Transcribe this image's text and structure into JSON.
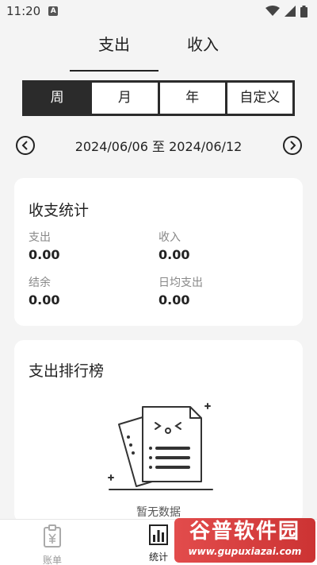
{
  "status_bar": {
    "time": "11:20",
    "notif_letter": "A",
    "icons": [
      "wifi-icon",
      "signal-icon",
      "battery-icon"
    ]
  },
  "type_tabs": [
    {
      "label": "支出",
      "active": true
    },
    {
      "label": "收入",
      "active": false
    }
  ],
  "period": {
    "options": [
      "周",
      "月",
      "年",
      "自定义"
    ],
    "selected": "周"
  },
  "date_range": "2024/06/06 至 2024/06/12",
  "summary": {
    "title": "收支统计",
    "expense_label": "支出",
    "expense_value": "0.00",
    "income_label": "收入",
    "income_value": "0.00",
    "balance_label": "结余",
    "balance_value": "0.00",
    "daily_label": "日均支出",
    "daily_value": "0.00"
  },
  "ranking": {
    "title": "支出排行榜",
    "empty_text": "暂无数据"
  },
  "bottom_nav": {
    "ledger_label": "账单",
    "stats_label": "统计"
  },
  "watermark": {
    "title": "谷普软件园",
    "url": "www.gupuxiazai.com"
  },
  "colors": {
    "accent": "#2b2b2b",
    "card": "#ffffff",
    "background": "#f4f4f4",
    "watermark": "#d33a3a"
  }
}
